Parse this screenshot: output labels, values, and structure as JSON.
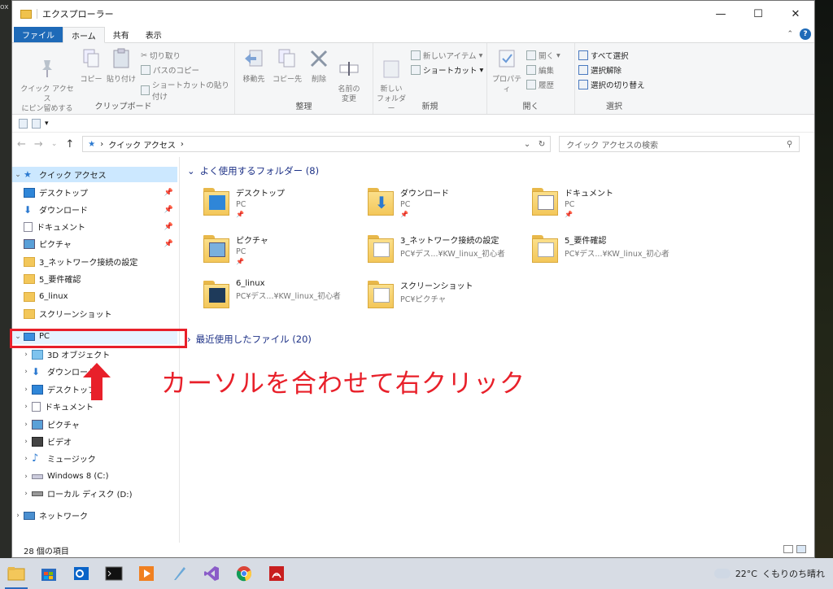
{
  "desktop": {
    "edge_text": "ox"
  },
  "window": {
    "title": "エクスプローラー",
    "controls": {
      "minimize": "—",
      "maximize": "☐",
      "close": "✕"
    }
  },
  "ribbon_tabs": [
    "ファイル",
    "ホーム",
    "共有",
    "表示"
  ],
  "help_label": "?",
  "ribbon": {
    "clipboard": {
      "pin": "クイック アクセス\nにピン留めする",
      "copy": "コピー",
      "paste": "貼り付け",
      "cut": "切り取り",
      "copy_path": "パスのコピー",
      "paste_shortcut": "ショートカットの貼り付け",
      "label": "クリップボード"
    },
    "organize": {
      "move_to": "移動先",
      "copy_to": "コピー先",
      "delete": "削除",
      "rename": "名前の\n変更",
      "label": "整理"
    },
    "new": {
      "new_folder": "新しい\nフォルダー",
      "new_item": "新しいアイテム",
      "shortcut": "ショートカット",
      "label": "新規"
    },
    "open": {
      "properties": "プロパティ",
      "open": "開く",
      "edit": "編集",
      "history": "履歴",
      "label": "開く"
    },
    "select": {
      "select_all": "すべて選択",
      "select_none": "選択解除",
      "invert": "選択の切り替え",
      "label": "選択"
    }
  },
  "address": {
    "path": "クイック アクセス",
    "sep": "›",
    "search_placeholder": "クイック アクセスの検索"
  },
  "nav": {
    "quick_access": "クイック アクセス",
    "qa_items": [
      "デスクトップ",
      "ダウンロード",
      "ドキュメント",
      "ピクチャ",
      "3_ネットワーク接続の設定",
      "5_要件確認",
      "6_linux",
      "スクリーンショット"
    ],
    "pc": "PC",
    "pc_items": [
      "3D オブジェクト",
      "ダウンロード",
      "デスクトップ",
      "ドキュメント",
      "ピクチャ",
      "ビデオ",
      "ミュージック",
      "Windows 8 (C:)",
      "ローカル ディスク (D:)"
    ],
    "network": "ネットワーク"
  },
  "main": {
    "frequent_header": "よく使用するフォルダー (8)",
    "recent_header": "最近使用したファイル (20)",
    "tiles": [
      {
        "name": "デスクトップ",
        "sub": "PC",
        "pinned": "📌"
      },
      {
        "name": "ダウンロード",
        "sub": "PC",
        "pinned": "📌"
      },
      {
        "name": "ドキュメント",
        "sub": "PC",
        "pinned": "📌"
      },
      {
        "name": "ピクチャ",
        "sub": "PC",
        "pinned": "📌"
      },
      {
        "name": "3_ネットワーク接続の設定",
        "sub": "PC¥デス...¥KW_linux_初心者",
        "pinned": ""
      },
      {
        "name": "5_要件確認",
        "sub": "PC¥デス...¥KW_linux_初心者",
        "pinned": ""
      },
      {
        "name": "6_linux",
        "sub": "PC¥デス...¥KW_linux_初心者",
        "pinned": ""
      },
      {
        "name": "スクリーンショット",
        "sub": "PC¥ピクチャ",
        "pinned": ""
      }
    ]
  },
  "status": {
    "count": "28 個の項目"
  },
  "annotation": {
    "text": "カーソルを合わせて右クリック",
    "color": "#e8202a"
  },
  "tray": {
    "temp": "22°C",
    "weather": "くもりのち晴れ"
  },
  "colors": {
    "accent": "#1e6ab8",
    "folder": "#f3c75a",
    "selection": "#cce8ff"
  }
}
